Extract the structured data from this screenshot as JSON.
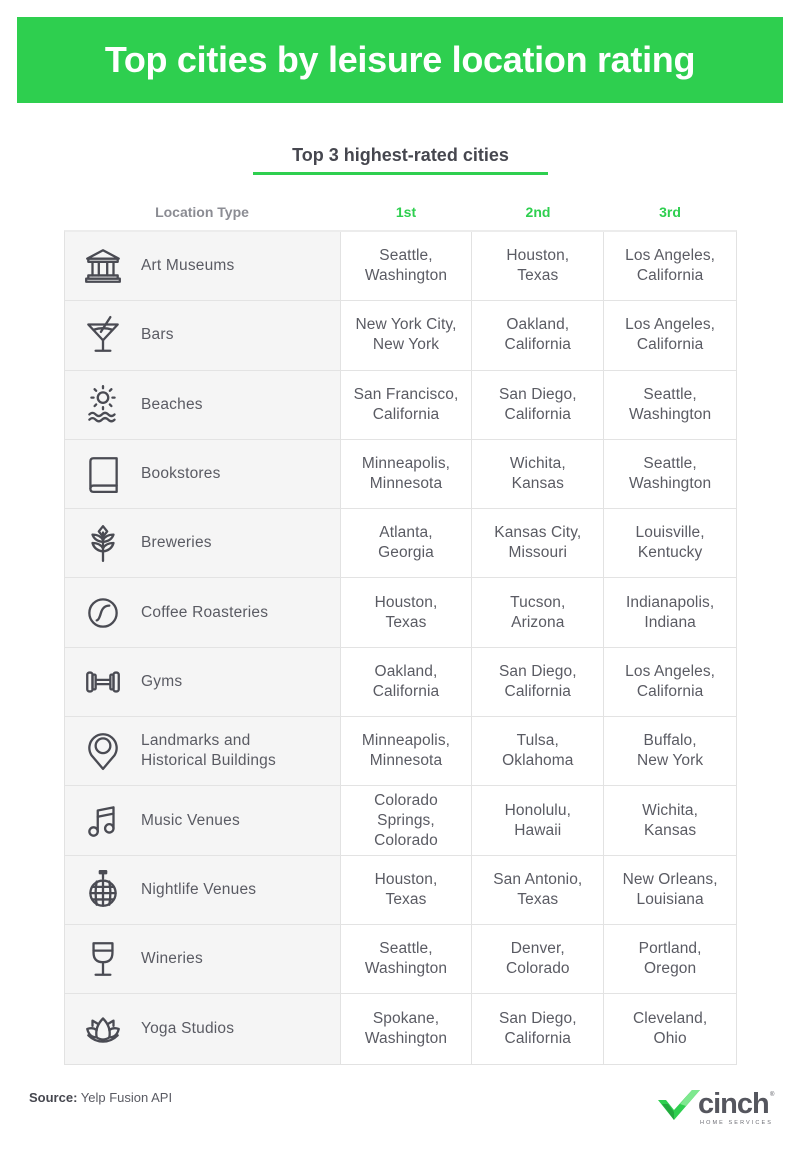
{
  "title": "Top cities by leisure location rating",
  "subtitle": "Top 3 highest-rated cities",
  "columns": {
    "type": "Location Type",
    "first": "1st",
    "second": "2nd",
    "third": "3rd"
  },
  "colors": {
    "accent": "#2ecf4f",
    "text": "#55565e",
    "type_column_bg": "#f5f5f5",
    "border": "#e2e2e2"
  },
  "rows": [
    {
      "icon": "museum-icon",
      "type": "Art Museums",
      "first": "Seattle,\nWashington",
      "second": "Houston,\nTexas",
      "third": "Los Angeles,\nCalifornia"
    },
    {
      "icon": "cocktail-icon",
      "type": "Bars",
      "first": "New York City,\nNew York",
      "second": "Oakland,\nCalifornia",
      "third": "Los Angeles,\nCalifornia"
    },
    {
      "icon": "sun-waves-icon",
      "type": "Beaches",
      "first": "San Francisco,\nCalifornia",
      "second": "San Diego,\nCalifornia",
      "third": "Seattle,\nWashington"
    },
    {
      "icon": "book-icon",
      "type": "Bookstores",
      "first": "Minneapolis,\nMinnesota",
      "second": "Wichita,\nKansas",
      "third": "Seattle,\nWashington"
    },
    {
      "icon": "wheat-icon",
      "type": "Breweries",
      "first": "Atlanta,\nGeorgia",
      "second": "Kansas City,\nMissouri",
      "third": "Louisville,\nKentucky"
    },
    {
      "icon": "coffee-bean-icon",
      "type": "Coffee Roasteries",
      "first": "Houston,\nTexas",
      "second": "Tucson,\nArizona",
      "third": "Indianapolis,\nIndiana"
    },
    {
      "icon": "dumbbell-icon",
      "type": "Gyms",
      "first": "Oakland,\nCalifornia",
      "second": "San Diego,\nCalifornia",
      "third": "Los Angeles,\nCalifornia"
    },
    {
      "icon": "map-pin-icon",
      "type": "Landmarks and Historical Buildings",
      "first": "Minneapolis,\nMinnesota",
      "second": "Tulsa,\nOklahoma",
      "third": "Buffalo,\nNew York"
    },
    {
      "icon": "music-note-icon",
      "type": "Music Venues",
      "first": "Colorado\nSprings,\nColorado",
      "second": "Honolulu,\nHawaii",
      "third": "Wichita,\nKansas"
    },
    {
      "icon": "disco-ball-icon",
      "type": "Nightlife Venues",
      "first": "Houston,\nTexas",
      "second": "San Antonio,\nTexas",
      "third": "New Orleans,\nLouisiana"
    },
    {
      "icon": "wine-glass-icon",
      "type": "Wineries",
      "first": "Seattle,\nWashington",
      "second": "Denver,\nColorado",
      "third": "Portland,\nOregon"
    },
    {
      "icon": "lotus-icon",
      "type": "Yoga Studios",
      "first": "Spokane,\nWashington",
      "second": "San Diego,\nCalifornia",
      "third": "Cleveland,\nOhio"
    }
  ],
  "footer": {
    "source_label": "Source:",
    "source_text": " Yelp Fusion API",
    "logo_word": "cinch",
    "logo_reg": "®",
    "logo_sub": "HOME SERVICES"
  }
}
